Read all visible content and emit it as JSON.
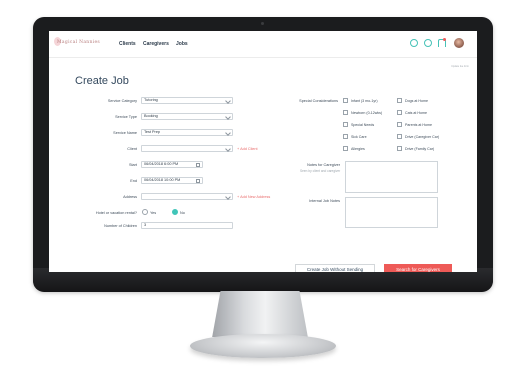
{
  "app": {
    "logo_text": "Magical Nannies",
    "nav": [
      "Clients",
      "Caregivers",
      "Jobs"
    ],
    "corner_note": "Update fee form"
  },
  "page": {
    "title": "Create Job"
  },
  "form": {
    "service_category": {
      "label": "Service Category",
      "value": "Tutoring"
    },
    "service_type": {
      "label": "Service Type",
      "value": "Booking"
    },
    "service_name": {
      "label": "Service Name",
      "value": "Test Prep"
    },
    "client": {
      "label": "Client",
      "value": "",
      "link": "+ Add Client"
    },
    "start": {
      "label": "Start",
      "value": "06/04/2018 6:00 PM"
    },
    "end": {
      "label": "End",
      "value": "06/04/2018 10:00 PM"
    },
    "address": {
      "label": "Address",
      "value": "",
      "link": "+ Add New Address"
    },
    "hotel": {
      "label": "Hotel or vacation rental?",
      "yes": "Yes",
      "no": "No",
      "selected": "No"
    },
    "children": {
      "label": "Number of Children",
      "value": "3"
    }
  },
  "special": {
    "label": "Special Considerations",
    "items": [
      "Infant (3 mo-1yr)",
      "Dogs at Home",
      "Newborn (0-12wks)",
      "Cats at Home",
      "Special Needs",
      "Parents at Home",
      "Sick Care",
      "Drive (Caregiver Car)",
      "Allergies",
      "Drive (Family Car)"
    ]
  },
  "notes": {
    "caregiver_label": "Notes for Caregiver",
    "caregiver_sub": "Seen by client and caregiver",
    "internal_label": "Internal Job Notes"
  },
  "actions": {
    "create_without_sending": "Create Job Without Sending",
    "search": "Search for Caregivers"
  },
  "colors": {
    "accent": "#40c5b8",
    "danger": "#ee5a57",
    "title": "#34495e"
  }
}
